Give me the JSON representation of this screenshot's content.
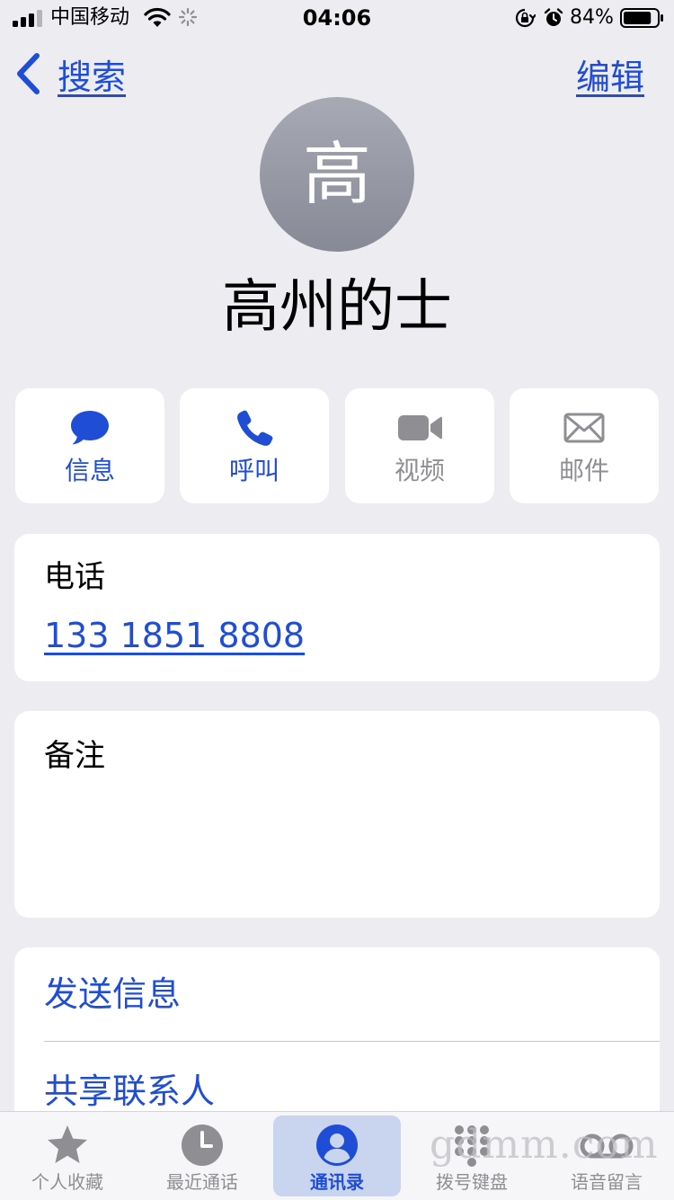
{
  "status_bar": {
    "carrier": "中国移动",
    "time": "04:06",
    "battery": "84%",
    "battery_level": 0.84
  },
  "nav": {
    "back_label": "搜索",
    "edit_label": "编辑"
  },
  "contact": {
    "initial": "高",
    "name": "高州的士"
  },
  "actions": [
    {
      "label": "信息",
      "icon": "message-bubble-icon",
      "enabled": true
    },
    {
      "label": "呼叫",
      "icon": "phone-icon",
      "enabled": true
    },
    {
      "label": "视频",
      "icon": "video-camera-icon",
      "enabled": false
    },
    {
      "label": "邮件",
      "icon": "envelope-icon",
      "enabled": false
    }
  ],
  "phone": {
    "label": "电话",
    "number": "133 1851 8808"
  },
  "notes": {
    "label": "备注"
  },
  "links": [
    {
      "label": "发送信息"
    },
    {
      "label": "共享联系人"
    }
  ],
  "tabs": [
    {
      "label": "个人收藏",
      "icon": "star-icon",
      "active": false
    },
    {
      "label": "最近通话",
      "icon": "clock-icon",
      "active": false
    },
    {
      "label": "通讯录",
      "icon": "person-circle-icon",
      "active": true
    },
    {
      "label": "拨号键盘",
      "icon": "keypad-icon",
      "active": false
    },
    {
      "label": "语音留言",
      "icon": "voicemail-icon",
      "active": false
    }
  ],
  "watermark": "gdmm.com",
  "colors": {
    "accent": "#1f4dd6",
    "background": "#ececf1",
    "disabled": "#8e8e93",
    "tab_active_bg": "#c9d4ef"
  }
}
